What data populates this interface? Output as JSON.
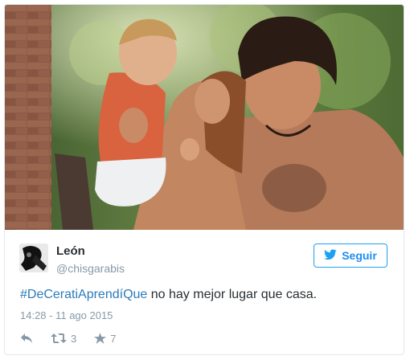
{
  "tweet": {
    "author_name": "León",
    "author_handle": "@chisgarabis",
    "follow_label": "Seguir",
    "hashtag": "#DeCeratiAprendíQue",
    "text": " no hay mejor lugar que casa.",
    "timestamp": "14:28 - 11 ago 2015",
    "retweets": "3",
    "likes": "7"
  },
  "icons": {
    "reply": "reply-icon",
    "retweet": "retweet-icon",
    "favorite": "star-icon",
    "follow": "twitter-bird-icon"
  },
  "colors": {
    "accent": "#1da1f2",
    "hashtag": "#2b7bb9",
    "muted": "#8899a6",
    "text": "#292f33"
  }
}
